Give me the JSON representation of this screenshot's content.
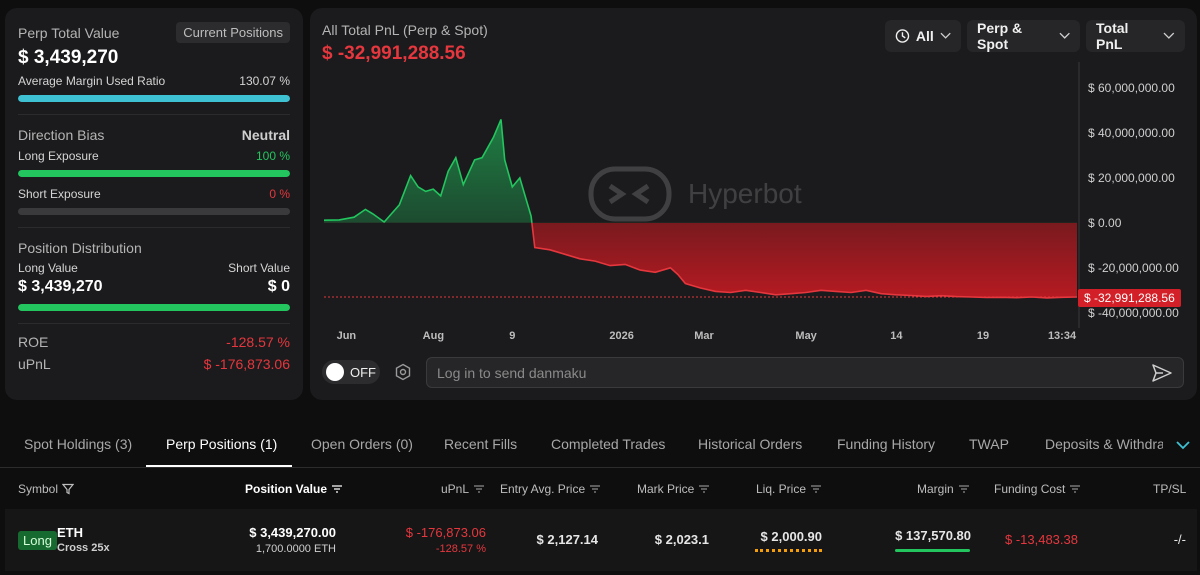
{
  "summary": {
    "perp_total_value_label": "Perp Total Value",
    "perp_total_value": "$ 3,439,270",
    "current_positions_label": "Current Positions",
    "avg_margin_label": "Average Margin Used Ratio",
    "avg_margin_value": "130.07 %",
    "avg_margin_fill": 1.0,
    "direction_bias_label": "Direction Bias",
    "direction_bias_value": "Neutral",
    "long_exposure_label": "Long Exposure",
    "long_exposure_value": "100 %",
    "long_exposure_fill": 1.0,
    "short_exposure_label": "Short Exposure",
    "short_exposure_value": "0 %",
    "short_exposure_fill": 0.0,
    "position_distribution_label": "Position Distribution",
    "long_value_label": "Long Value",
    "short_value_label": "Short Value",
    "long_value": "$ 3,439,270",
    "short_value": "$ 0",
    "distribution_fill": 1.0,
    "roe_label": "ROE",
    "roe_value": "-128.57 %",
    "upnl_label": "uPnL",
    "upnl_value": "$ -176,873.06"
  },
  "chart_panel": {
    "title": "All Total PnL (Perp & Spot)",
    "total": "$ -32,991,288.56",
    "filter_range": "All",
    "filter_market": "Perp & Spot",
    "filter_metric": "Total PnL",
    "watermark": "Hyperbot",
    "current_value_label": "$ -32,991,288.56",
    "danmaku_toggle": "OFF",
    "danmaku_placeholder": "Log in to send danmaku"
  },
  "chart_data": {
    "type": "area",
    "title": "All Total PnL (Perp & Spot)",
    "xlabel": "",
    "ylabel": "",
    "ylim": [
      -45000000,
      68000000
    ],
    "yticks": [
      {
        "value": 60000000,
        "label": "$ 60,000,000.00"
      },
      {
        "value": 40000000,
        "label": "$ 40,000,000.00"
      },
      {
        "value": 20000000,
        "label": "$ 20,000,000.00"
      },
      {
        "value": 0,
        "label": "$ 0.00"
      },
      {
        "value": -20000000,
        "label": "$ -20,000,000.00"
      },
      {
        "value": -40000000,
        "label": "$ -40,000,000.00"
      }
    ],
    "xticks": [
      {
        "t": 0.03,
        "label": "Jun"
      },
      {
        "t": 0.145,
        "label": "Aug"
      },
      {
        "t": 0.25,
        "label": "9"
      },
      {
        "t": 0.395,
        "label": "2026"
      },
      {
        "t": 0.505,
        "label": "Mar"
      },
      {
        "t": 0.64,
        "label": "May"
      },
      {
        "t": 0.76,
        "label": "14"
      },
      {
        "t": 0.875,
        "label": "19"
      },
      {
        "t": 0.98,
        "label": "13:34"
      }
    ],
    "series": [
      {
        "values": [
          [
            0.0,
            1200000
          ],
          [
            0.02,
            1300000
          ],
          [
            0.04,
            2500000
          ],
          [
            0.055,
            6000000
          ],
          [
            0.065,
            4000000
          ],
          [
            0.08,
            400000
          ],
          [
            0.09,
            4200000
          ],
          [
            0.1,
            8000000
          ],
          [
            0.115,
            21000000
          ],
          [
            0.125,
            16000000
          ],
          [
            0.135,
            14000000
          ],
          [
            0.145,
            15000000
          ],
          [
            0.155,
            12000000
          ],
          [
            0.165,
            23000000
          ],
          [
            0.175,
            29000000
          ],
          [
            0.185,
            17000000
          ],
          [
            0.2,
            28000000
          ],
          [
            0.21,
            29000000
          ],
          [
            0.225,
            38000000
          ],
          [
            0.235,
            46000000
          ],
          [
            0.24,
            28000000
          ],
          [
            0.25,
            16000000
          ],
          [
            0.26,
            20000000
          ],
          [
            0.275,
            3000000
          ],
          [
            0.28,
            -11000000
          ],
          [
            0.3,
            -12000000
          ],
          [
            0.32,
            -14000000
          ],
          [
            0.34,
            -16000000
          ],
          [
            0.36,
            -17000000
          ],
          [
            0.38,
            -19000000
          ],
          [
            0.4,
            -18500000
          ],
          [
            0.42,
            -21000000
          ],
          [
            0.44,
            -22000000
          ],
          [
            0.46,
            -20000000
          ],
          [
            0.47,
            -23000000
          ],
          [
            0.48,
            -27000000
          ],
          [
            0.5,
            -29000000
          ],
          [
            0.52,
            -30500000
          ],
          [
            0.54,
            -31000000
          ],
          [
            0.56,
            -30000000
          ],
          [
            0.58,
            -31000000
          ],
          [
            0.6,
            -32000000
          ],
          [
            0.62,
            -31500000
          ],
          [
            0.64,
            -31000000
          ],
          [
            0.66,
            -30000000
          ],
          [
            0.68,
            -30500000
          ],
          [
            0.7,
            -31000000
          ],
          [
            0.72,
            -30000000
          ],
          [
            0.74,
            -31500000
          ],
          [
            0.76,
            -32000000
          ],
          [
            0.78,
            -32300000
          ],
          [
            0.8,
            -32700000
          ],
          [
            0.82,
            -32400000
          ],
          [
            0.84,
            -32800000
          ],
          [
            0.86,
            -33000000
          ],
          [
            0.88,
            -33200000
          ],
          [
            0.9,
            -33100000
          ],
          [
            0.92,
            -33300000
          ],
          [
            0.94,
            -33000000
          ],
          [
            0.96,
            -33400000
          ],
          [
            0.98,
            -33100000
          ],
          [
            1.0,
            -33000000
          ]
        ]
      }
    ],
    "current_value": -32991288.56,
    "grid": false,
    "legend": "none",
    "colors": {
      "positive": "#22c55e",
      "negative": "#e5373d"
    }
  },
  "tabs": [
    {
      "label": "Spot Holdings (3)"
    },
    {
      "label": "Perp Positions (1)"
    },
    {
      "label": "Open Orders (0)"
    },
    {
      "label": "Recent Fills"
    },
    {
      "label": "Completed Trades"
    },
    {
      "label": "Historical Orders"
    },
    {
      "label": "Funding History"
    },
    {
      "label": "TWAP"
    },
    {
      "label": "Deposits & Withdraw"
    }
  ],
  "table": {
    "headers": {
      "symbol": "Symbol",
      "position_value": "Position Value",
      "upnl": "uPnL",
      "entry": "Entry Avg. Price",
      "mark": "Mark Price",
      "liq": "Liq. Price",
      "margin": "Margin",
      "funding": "Funding Cost",
      "tpsl": "TP/SL"
    },
    "rows": [
      {
        "side": "Long",
        "coin": "ETH",
        "leverage": "Cross 25x",
        "position_value": "$ 3,439,270.00",
        "position_size": "1,700.0000 ETH",
        "upnl": "$ -176,873.06",
        "upnl_pct": "-128.57 %",
        "entry": "$ 2,127.14",
        "mark": "$ 2,023.1",
        "liq": "$ 2,000.90",
        "margin": "$ 137,570.80",
        "funding": "$ -13,483.38",
        "tpsl": "-/-"
      }
    ]
  },
  "colors": {
    "background": "#0e0e0f",
    "card": "#1b1b1d",
    "positive": "#22c55e",
    "negative": "#e5373d",
    "accent_cyan": "#3ec1d3"
  }
}
